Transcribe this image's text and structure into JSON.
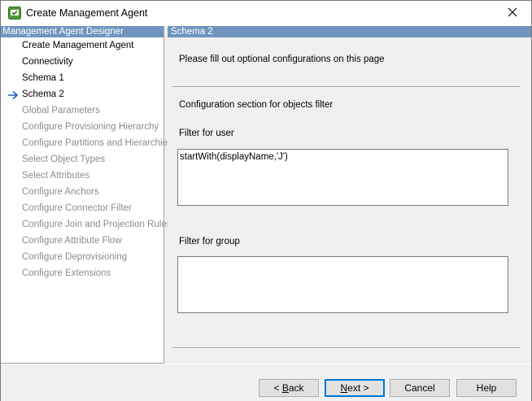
{
  "window": {
    "title": "Create Management Agent"
  },
  "left_pane": {
    "header": "Management Agent Designer",
    "current_index": 3,
    "items": [
      {
        "label": "Create Management Agent",
        "state": "done"
      },
      {
        "label": "Connectivity",
        "state": "done"
      },
      {
        "label": "Schema 1",
        "state": "done"
      },
      {
        "label": "Schema 2",
        "state": "current"
      },
      {
        "label": "Global Parameters",
        "state": "pending"
      },
      {
        "label": "Configure Provisioning Hierarchy",
        "state": "pending"
      },
      {
        "label": "Configure Partitions and Hierarchies",
        "state": "pending"
      },
      {
        "label": "Select Object Types",
        "state": "pending"
      },
      {
        "label": "Select Attributes",
        "state": "pending"
      },
      {
        "label": "Configure Anchors",
        "state": "pending"
      },
      {
        "label": "Configure Connector Filter",
        "state": "pending"
      },
      {
        "label": "Configure Join and Projection Rules",
        "state": "pending"
      },
      {
        "label": "Configure Attribute Flow",
        "state": "pending"
      },
      {
        "label": "Configure Deprovisioning",
        "state": "pending"
      },
      {
        "label": "Configure Extensions",
        "state": "pending"
      }
    ]
  },
  "right_pane": {
    "header": "Schema 2",
    "intro": "Please fill out optional configurations on this page",
    "section_title": "Configuration section for objects filter",
    "user_filter": {
      "label": "Filter for user",
      "value": "startWith(displayName,'J')"
    },
    "group_filter": {
      "label": "Filter for group",
      "value": ""
    }
  },
  "footer": {
    "back": {
      "pre": "< ",
      "key": "B",
      "post": "ack"
    },
    "next": {
      "pre": "",
      "key": "N",
      "post": "ext >"
    },
    "cancel": "Cancel",
    "help": "Help"
  },
  "colors": {
    "header_bg": "#6f95be",
    "arrow": "#1f5fbf",
    "default_button_border": "#0078d7",
    "pending_text": "#8c8c8c"
  }
}
